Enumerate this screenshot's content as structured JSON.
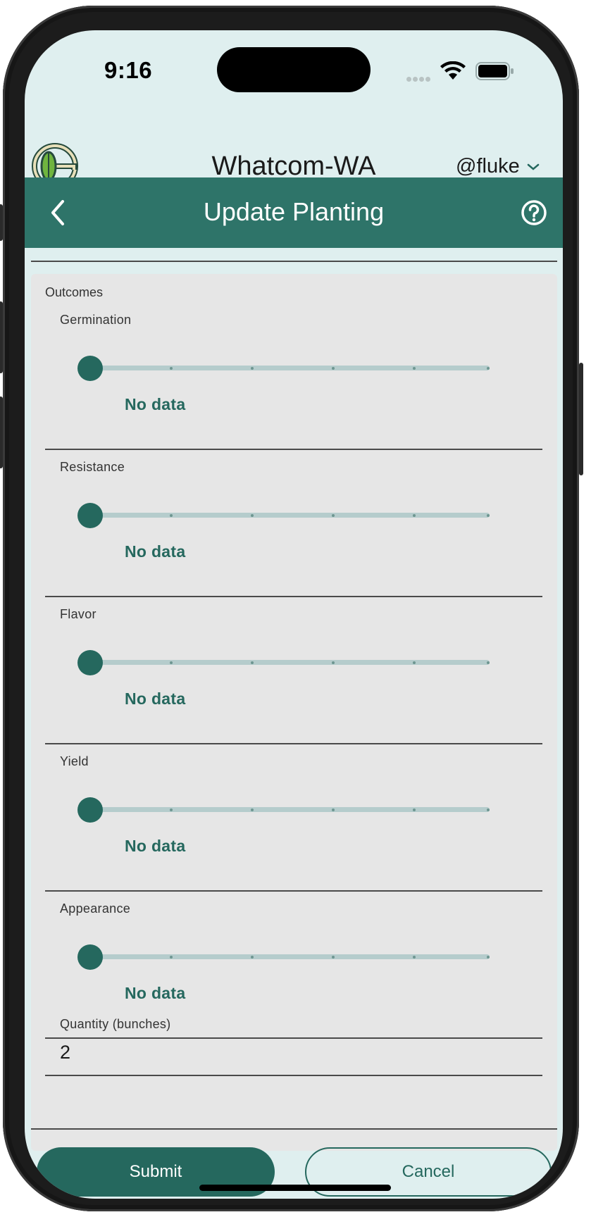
{
  "status_bar": {
    "time": "9:16"
  },
  "app_header": {
    "title": "Whatcom-WA",
    "user": "@fluke"
  },
  "nav": {
    "title": "Update Planting"
  },
  "outcomes": {
    "section_label": "Outcomes",
    "fields": [
      {
        "label": "Germination",
        "value_text": "No data",
        "level": 0
      },
      {
        "label": "Resistance",
        "value_text": "No data",
        "level": 0
      },
      {
        "label": "Flavor",
        "value_text": "No data",
        "level": 0
      },
      {
        "label": "Yield",
        "value_text": "No data",
        "level": 0
      },
      {
        "label": "Appearance",
        "value_text": "No data",
        "level": 0
      }
    ]
  },
  "quantity": {
    "label": "Quantity (bunches)",
    "value": "2"
  },
  "actions": {
    "submit_label": "Submit",
    "cancel_label": "Cancel"
  },
  "colors": {
    "accent": "#2e7469",
    "thumb": "#25685e",
    "background": "#dfefef",
    "panel": "#e6e6e6"
  }
}
